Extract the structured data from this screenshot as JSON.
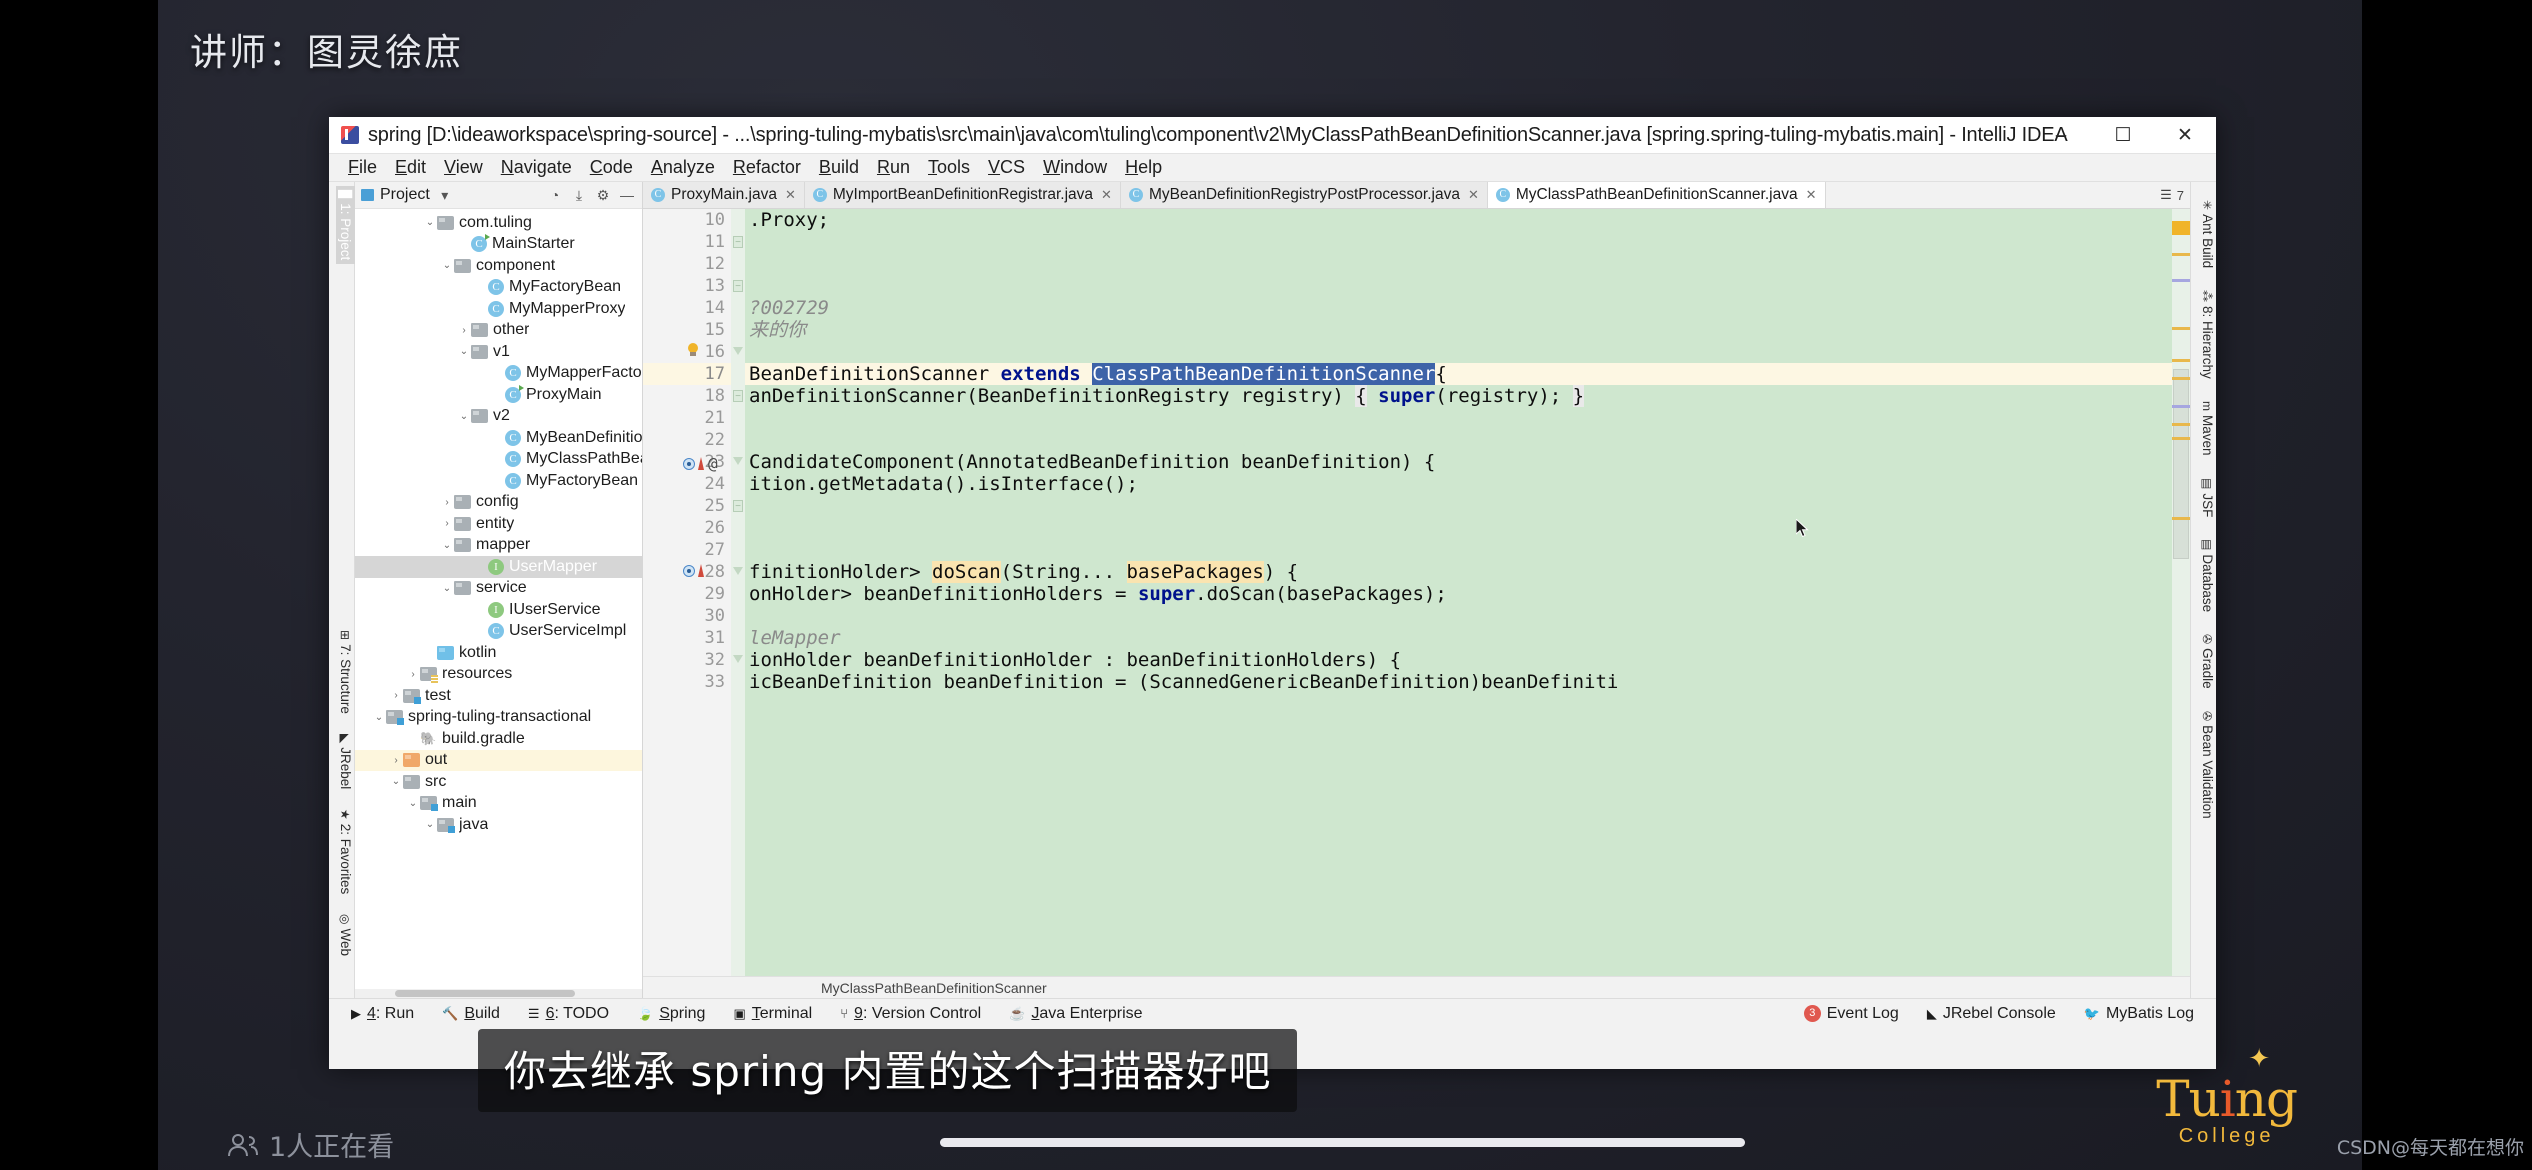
{
  "overlay": {
    "presenter": "讲师：图灵徐庶",
    "subtitle": "你去继承 spring 内置的这个扫描器好吧",
    "viewers": "1人正在看",
    "viewers_icon": "people-icon",
    "watermark": "CSDN@每天都在想你",
    "logo_text_a": "Tu",
    "logo_text_i": "i",
    "logo_text_b": "ng",
    "logo_sub": "College"
  },
  "window": {
    "title": "spring [D:\\ideaworkspace\\spring-source] - ...\\spring-tuling-mybatis\\src\\main\\java\\com\\tuling\\component\\v2\\MyClassPathBeanDefinitionScanner.java [spring.spring-tuling-mybatis.main] - IntelliJ IDEA",
    "app_icon": "intellij-idea-icon",
    "minimize": "–",
    "maximize": "☐",
    "close": "✕"
  },
  "menubar": [
    {
      "label": "File"
    },
    {
      "label": "Edit"
    },
    {
      "label": "View"
    },
    {
      "label": "Navigate"
    },
    {
      "label": "Code"
    },
    {
      "label": "Analyze"
    },
    {
      "label": "Refactor"
    },
    {
      "label": "Build"
    },
    {
      "label": "Run"
    },
    {
      "label": "Tools"
    },
    {
      "label": "VCS"
    },
    {
      "label": "Window"
    },
    {
      "label": "Help"
    }
  ],
  "left_tool_tabs": [
    {
      "label": "1: Project",
      "icon": "project-icon",
      "selected": true
    },
    {
      "label": "7: Structure",
      "icon": "structure-icon",
      "selected": false
    },
    {
      "label": "JRebel",
      "icon": "jrebel-icon",
      "selected": false
    },
    {
      "label": "2: Favorites",
      "icon": "star-icon",
      "selected": false
    },
    {
      "label": "Web",
      "icon": "web-icon",
      "selected": false
    }
  ],
  "right_tool_tabs": [
    {
      "label": "Ant Build",
      "icon": "ant-icon"
    },
    {
      "label": "8: Hierarchy",
      "icon": "hierarchy-icon"
    },
    {
      "label": "Maven",
      "icon": "maven-icon"
    },
    {
      "label": "JSF",
      "icon": "jsf-icon"
    },
    {
      "label": "Database",
      "icon": "database-icon"
    },
    {
      "label": "Gradle",
      "icon": "gradle-icon"
    },
    {
      "label": "Bean Validation",
      "icon": "bean-validation-icon"
    }
  ],
  "project_panel": {
    "title": "Project",
    "dropdown_icon": "chevron-down-icon",
    "icons": [
      "collapse-all-icon",
      "expand-all-icon",
      "settings-gear-icon",
      "hide-icon"
    ],
    "tree": [
      {
        "label": "com.tuling",
        "indent": 4,
        "arrow": "down",
        "icon": "package"
      },
      {
        "label": "MainStarter",
        "indent": 6,
        "arrow": "",
        "icon": "class-run"
      },
      {
        "label": "component",
        "indent": 5,
        "arrow": "down",
        "icon": "package"
      },
      {
        "label": "MyFactoryBean",
        "indent": 7,
        "arrow": "",
        "icon": "class"
      },
      {
        "label": "MyMapperProxy",
        "indent": 7,
        "arrow": "",
        "icon": "class"
      },
      {
        "label": "other",
        "indent": 6,
        "arrow": "right",
        "icon": "package"
      },
      {
        "label": "v1",
        "indent": 6,
        "arrow": "down",
        "icon": "package"
      },
      {
        "label": "MyMapperFactory",
        "indent": 8,
        "arrow": "",
        "icon": "class"
      },
      {
        "label": "ProxyMain",
        "indent": 8,
        "arrow": "",
        "icon": "class-run"
      },
      {
        "label": "v2",
        "indent": 6,
        "arrow": "down",
        "icon": "package"
      },
      {
        "label": "MyBeanDefinitionRegistryP",
        "indent": 8,
        "arrow": "",
        "icon": "class"
      },
      {
        "label": "MyClassPathBeanDefinition",
        "indent": 8,
        "arrow": "",
        "icon": "class"
      },
      {
        "label": "MyFactoryBean",
        "indent": 8,
        "arrow": "",
        "icon": "class"
      },
      {
        "label": "config",
        "indent": 5,
        "arrow": "right",
        "icon": "package"
      },
      {
        "label": "entity",
        "indent": 5,
        "arrow": "right",
        "icon": "package"
      },
      {
        "label": "mapper",
        "indent": 5,
        "arrow": "down",
        "icon": "package"
      },
      {
        "label": "UserMapper",
        "indent": 7,
        "arrow": "",
        "icon": "interface",
        "state": "selected"
      },
      {
        "label": "service",
        "indent": 5,
        "arrow": "down",
        "icon": "package"
      },
      {
        "label": "IUserService",
        "indent": 7,
        "arrow": "",
        "icon": "interface"
      },
      {
        "label": "UserServiceImpl",
        "indent": 7,
        "arrow": "",
        "icon": "class"
      },
      {
        "label": "kotlin",
        "indent": 4,
        "arrow": "",
        "icon": "folder-blue"
      },
      {
        "label": "resources",
        "indent": 3,
        "arrow": "right",
        "icon": "folder-res"
      },
      {
        "label": "test",
        "indent": 2,
        "arrow": "right",
        "icon": "folder-src"
      },
      {
        "label": "spring-tuling-transactional",
        "indent": 1,
        "arrow": "down",
        "icon": "folder-src"
      },
      {
        "label": "build.gradle",
        "indent": 3,
        "arrow": "",
        "icon": "gradle"
      },
      {
        "label": "out",
        "indent": 2,
        "arrow": "right",
        "icon": "folder-orange",
        "state": "highlight"
      },
      {
        "label": "src",
        "indent": 2,
        "arrow": "down",
        "icon": "folder-plain"
      },
      {
        "label": "main",
        "indent": 3,
        "arrow": "down",
        "icon": "folder-src"
      },
      {
        "label": "java",
        "indent": 4,
        "arrow": "down",
        "icon": "folder-src"
      }
    ]
  },
  "editor_tabs": [
    {
      "label": "ProxyMain.java",
      "icon": "class-run-icon",
      "active": false,
      "close": "✕"
    },
    {
      "label": "MyImportBeanDefinitionRegistrar.java",
      "icon": "class-icon",
      "active": false,
      "close": "✕"
    },
    {
      "label": "MyBeanDefinitionRegistryPostProcessor.java",
      "icon": "class-icon",
      "active": false,
      "close": "✕"
    },
    {
      "label": "MyClassPathBeanDefinitionScanner.java",
      "icon": "class-icon",
      "active": true,
      "close": "✕"
    }
  ],
  "tabs_right_label": "7",
  "editor": {
    "breadcrumb": "MyClassPathBeanDefinitionScanner",
    "current_line": 17,
    "selected_text": "ClassPathBeanDefinitionScanner",
    "lines": [
      {
        "n": 10,
        "html": ".Proxy;"
      },
      {
        "n": 11,
        "html": ""
      },
      {
        "n": 12,
        "html": ""
      },
      {
        "n": 13,
        "html": ""
      },
      {
        "n": 14,
        "html": "<span class='cmt'>?002729</span>"
      },
      {
        "n": 15,
        "html": "<span class='cmt'>来的你</span>"
      },
      {
        "n": 16,
        "html": ""
      },
      {
        "n": 17,
        "html": "BeanDefinitionScanner <span class='kw'>extends</span> <span class='sel'>ClassPathBeanDefinitionScanner</span>{"
      },
      {
        "n": 18,
        "html": "anDefinitionScanner(BeanDefinitionRegistry registry) <span class='brk'>{</span> <span class='kw'>super</span>(registry); <span class='brk'>}</span>"
      },
      {
        "n": 21,
        "html": ""
      },
      {
        "n": 22,
        "html": ""
      },
      {
        "n": 23,
        "html": "CandidateComponent(AnnotatedBeanDefinition beanDefinition) {"
      },
      {
        "n": 24,
        "html": "ition.getMetadata().isInterface();"
      },
      {
        "n": 25,
        "html": ""
      },
      {
        "n": 26,
        "html": ""
      },
      {
        "n": 27,
        "html": ""
      },
      {
        "n": 28,
        "html": "finitionHolder&gt; <span class='occ'>doScan</span>(String... <span class='occ'>basePackages</span>) {"
      },
      {
        "n": 29,
        "html": "onHolder&gt; beanDefinitionHolders = <span class='kw'>super</span>.doScan(basePackages);"
      },
      {
        "n": 30,
        "html": ""
      },
      {
        "n": 31,
        "html": "<span class='cmt'>leMapper</span>"
      },
      {
        "n": 32,
        "html": "ionHolder beanDefinitionHolder : beanDefinitionHolders) {"
      },
      {
        "n": 33,
        "html": "icBeanDefinition beanDefinition = (ScannedGenericBeanDefinition)beanDefiniti"
      }
    ]
  },
  "statusbar_left": [
    {
      "label": "4: Run",
      "icon": "run-icon",
      "mnemonic": "4"
    },
    {
      "label": "Build",
      "icon": "build-hammer-icon",
      "mnemonic": ""
    },
    {
      "label": "6: TODO",
      "icon": "todo-list-icon",
      "mnemonic": "6"
    },
    {
      "label": "Spring",
      "icon": "spring-leaf-icon",
      "mnemonic": ""
    },
    {
      "label": "Terminal",
      "icon": "terminal-icon",
      "mnemonic": ""
    },
    {
      "label": "9: Version Control",
      "icon": "version-control-icon",
      "mnemonic": "9"
    },
    {
      "label": "Java Enterprise",
      "icon": "java-enterprise-icon",
      "mnemonic": ""
    }
  ],
  "statusbar_right": [
    {
      "label": "Event Log",
      "icon": "event-log-icon",
      "badge": "3"
    },
    {
      "label": "JRebel Console",
      "icon": "jrebel-icon",
      "badge": ""
    },
    {
      "label": "MyBatis Log",
      "icon": "mybatis-icon",
      "badge": ""
    }
  ],
  "colors": {
    "editor_bg": "#cfe7cf",
    "current_line": "#fdf7e3",
    "selection": "#3d63a8",
    "occurrence": "#fae4b0",
    "keyword": "#00128c",
    "accent_orange": "#f2b93c"
  }
}
